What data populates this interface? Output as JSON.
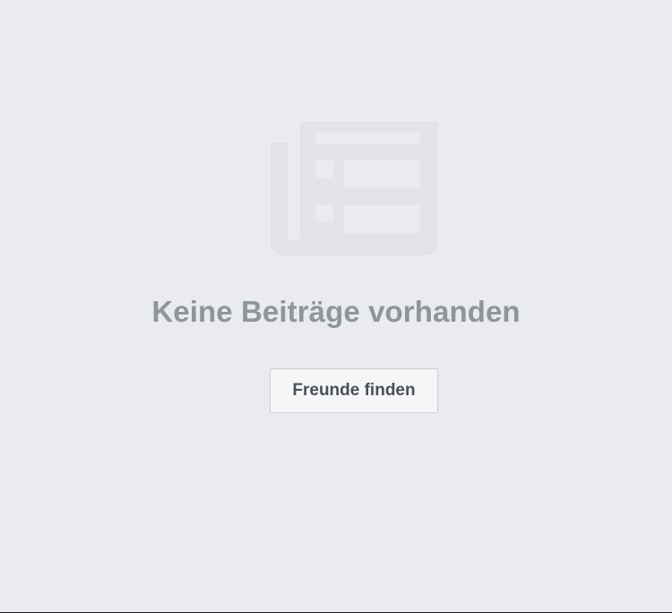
{
  "empty_state": {
    "icon": "newspaper-icon",
    "title": "Keine Beiträge vorhanden",
    "button_label": "Freunde finden"
  },
  "colors": {
    "background": "#e9ebee",
    "title": "#90949c",
    "button_bg": "#f5f6f7",
    "button_text": "#4b4f56",
    "icon_fill": "#e2e4e8"
  }
}
